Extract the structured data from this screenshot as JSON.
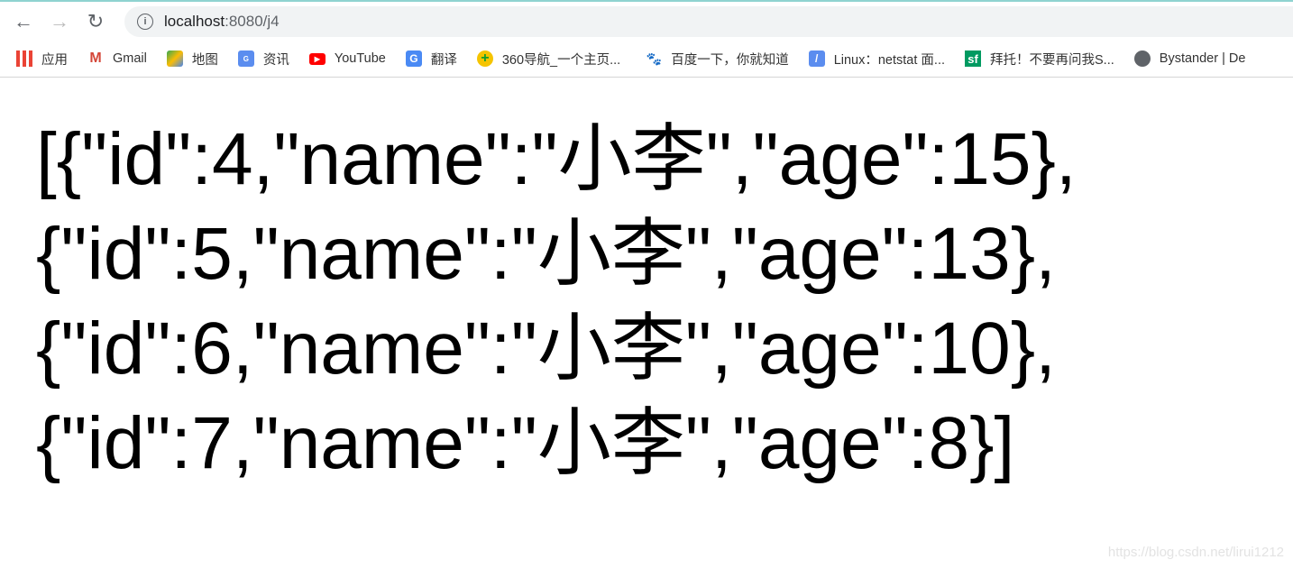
{
  "browser": {
    "url_host": "localhost",
    "url_rest": ":8080/j4",
    "bookmarks": [
      {
        "label": "应用",
        "icon": "apps-grid-icon"
      },
      {
        "label": "Gmail",
        "icon": "gmail-icon"
      },
      {
        "label": "地图",
        "icon": "maps-icon"
      },
      {
        "label": "资讯",
        "icon": "news-icon"
      },
      {
        "label": "YouTube",
        "icon": "youtube-icon"
      },
      {
        "label": "翻译",
        "icon": "translate-icon"
      },
      {
        "label": "360导航_一个主页...",
        "icon": "360-icon"
      },
      {
        "label": "百度一下，你就知道",
        "icon": "baidu-paw-icon"
      },
      {
        "label": "Linux：netstat 面...",
        "icon": "feather-icon"
      },
      {
        "label": "拜托！不要再问我S...",
        "icon": "sf-icon"
      },
      {
        "label": "Bystander | De",
        "icon": "globe-icon"
      }
    ]
  },
  "content": {
    "lines": [
      "[{\"id\":4,\"name\":\"小李\",\"age\":15},",
      "{\"id\":5,\"name\":\"小李\",\"age\":13},",
      "{\"id\":6,\"name\":\"小李\",\"age\":10},",
      "{\"id\":7,\"name\":\"小李\",\"age\":8}]"
    ]
  },
  "watermark": "https://blog.csdn.net/lirui1212"
}
